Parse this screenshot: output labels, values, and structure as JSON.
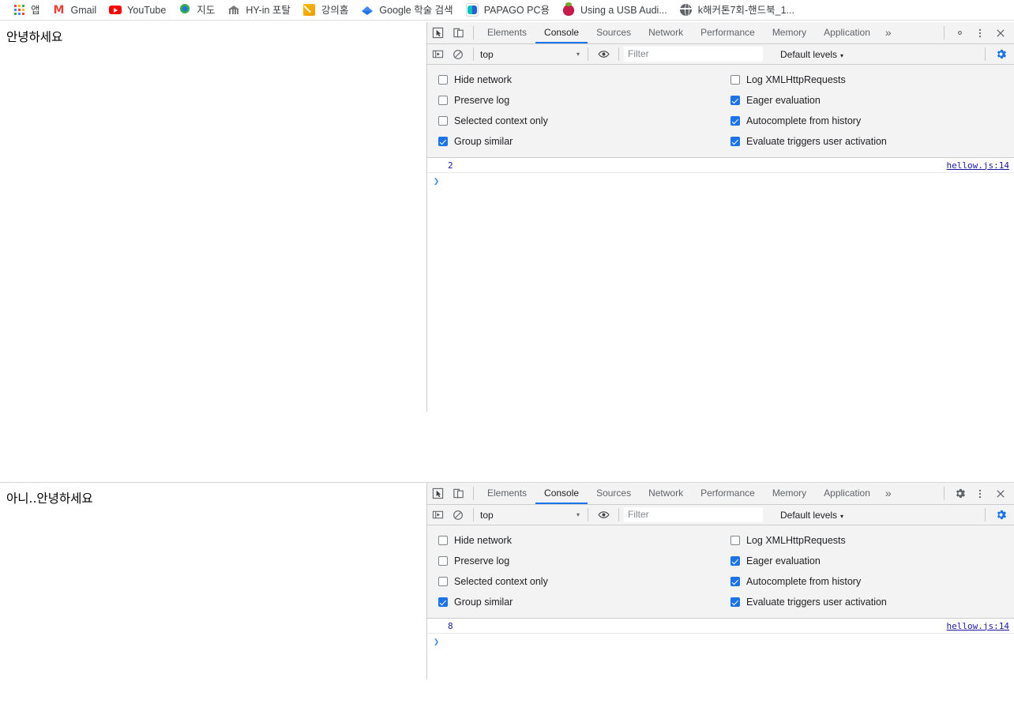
{
  "bookmarks_bar": {
    "items": [
      {
        "label": "앱",
        "icon": "apps-grid-icon"
      },
      {
        "label": "Gmail",
        "icon": "gmail-icon"
      },
      {
        "label": "YouTube",
        "icon": "youtube-icon"
      },
      {
        "label": "지도",
        "icon": "google-maps-pin-icon"
      },
      {
        "label": "HY-in 포탈",
        "icon": "university-bank-icon"
      },
      {
        "label": "강의홈",
        "icon": "pencil-note-icon"
      },
      {
        "label": "Google 학술 검색",
        "icon": "google-scholar-icon"
      },
      {
        "label": "PAPAGO PC용",
        "icon": "papago-icon"
      },
      {
        "label": "Using a USB Audi...",
        "icon": "raspberry-pi-icon"
      },
      {
        "label": "k해커톤7회-핸드북_1...",
        "icon": "globe-icon"
      }
    ]
  },
  "panels": [
    {
      "page": {
        "heading": "안녕하세요"
      },
      "devtools": {
        "tabs": [
          {
            "label": "Elements",
            "active": false
          },
          {
            "label": "Console",
            "active": true
          },
          {
            "label": "Sources",
            "active": false
          },
          {
            "label": "Network",
            "active": false
          },
          {
            "label": "Performance",
            "active": false
          },
          {
            "label": "Memory",
            "active": false
          },
          {
            "label": "Application",
            "active": false
          }
        ],
        "more_tabs_label": "»",
        "toolbar": {
          "context_value": "top",
          "filter_placeholder": "Filter",
          "levels_label": "Default levels",
          "caret": "▾"
        },
        "settings": {
          "left": [
            {
              "label": "Hide network",
              "checked": false
            },
            {
              "label": "Preserve log",
              "checked": false
            },
            {
              "label": "Selected context only",
              "checked": false
            },
            {
              "label": "Group similar",
              "checked": true
            }
          ],
          "right": [
            {
              "label": "Log XMLHttpRequests",
              "checked": false
            },
            {
              "label": "Eager evaluation",
              "checked": true
            },
            {
              "label": "Autocomplete from history",
              "checked": true
            },
            {
              "label": "Evaluate triggers user activation",
              "checked": true
            }
          ]
        },
        "console": {
          "message_value": "2",
          "message_source": "hellow.js:14",
          "prompt": "❯"
        }
      }
    },
    {
      "page": {
        "heading": "아니..안녕하세요"
      },
      "devtools": {
        "tabs": [
          {
            "label": "Elements",
            "active": false
          },
          {
            "label": "Console",
            "active": true
          },
          {
            "label": "Sources",
            "active": false
          },
          {
            "label": "Network",
            "active": false
          },
          {
            "label": "Performance",
            "active": false
          },
          {
            "label": "Memory",
            "active": false
          },
          {
            "label": "Application",
            "active": false
          }
        ],
        "more_tabs_label": "»",
        "toolbar": {
          "context_value": "top",
          "filter_placeholder": "Filter",
          "levels_label": "Default levels",
          "caret": "▾"
        },
        "settings": {
          "left": [
            {
              "label": "Hide network",
              "checked": false
            },
            {
              "label": "Preserve log",
              "checked": false
            },
            {
              "label": "Selected context only",
              "checked": false
            },
            {
              "label": "Group similar",
              "checked": true
            }
          ],
          "right": [
            {
              "label": "Log XMLHttpRequests",
              "checked": false
            },
            {
              "label": "Eager evaluation",
              "checked": true
            },
            {
              "label": "Autocomplete from history",
              "checked": true
            },
            {
              "label": "Evaluate triggers user activation",
              "checked": true
            }
          ]
        },
        "console": {
          "message_value": "8",
          "message_source": "hellow.js:14",
          "prompt": "❯"
        }
      }
    }
  ],
  "colors": {
    "accent": "#1a73e8",
    "console_value": "#1a1aa6",
    "toolbar_bg": "#f3f3f3",
    "border": "#cdcdcd"
  }
}
